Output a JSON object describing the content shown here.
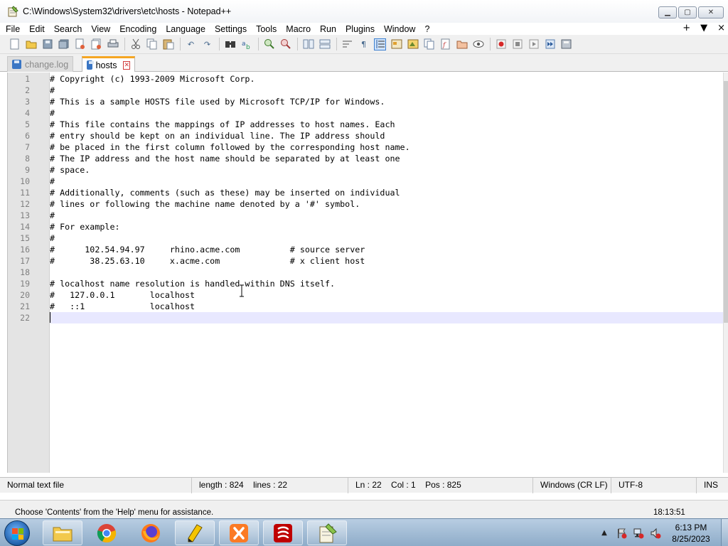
{
  "window": {
    "title": "C:\\Windows\\System32\\drivers\\etc\\hosts - Notepad++"
  },
  "menu": {
    "items": [
      "File",
      "Edit",
      "Search",
      "View",
      "Encoding",
      "Language",
      "Settings",
      "Tools",
      "Macro",
      "Run",
      "Plugins",
      "Window",
      "?"
    ],
    "right": [
      "+",
      "▼",
      "×"
    ]
  },
  "tabs": [
    {
      "label": "change.log",
      "active": false
    },
    {
      "label": "hosts",
      "active": true
    }
  ],
  "editor": {
    "lines": [
      "# Copyright (c) 1993-2009 Microsoft Corp.",
      "#",
      "# This is a sample HOSTS file used by Microsoft TCP/IP for Windows.",
      "#",
      "# This file contains the mappings of IP addresses to host names. Each",
      "# entry should be kept on an individual line. The IP address should",
      "# be placed in the first column followed by the corresponding host name.",
      "# The IP address and the host name should be separated by at least one",
      "# space.",
      "#",
      "# Additionally, comments (such as these) may be inserted on individual",
      "# lines or following the machine name denoted by a '#' symbol.",
      "#",
      "# For example:",
      "#",
      "#      102.54.94.97     rhino.acme.com          # source server",
      "#       38.25.63.10     x.acme.com              # x client host",
      "",
      "# localhost name resolution is handled within DNS itself.",
      "#   127.0.0.1       localhost",
      "#   ::1             localhost",
      ""
    ],
    "current_line": 22
  },
  "statusbar": {
    "file_type": "Normal text file",
    "length": "length : 824",
    "lines": "lines : 22",
    "ln": "Ln : 22",
    "col": "Col : 1",
    "pos": "Pos : 825",
    "eol": "Windows (CR LF)",
    "encoding": "UTF-8",
    "mode": "INS"
  },
  "hint": {
    "text": "Choose 'Contents' from the 'Help' menu for assistance.",
    "time": "18:13:51"
  },
  "taskbar": {
    "apps": [
      "file-explorer",
      "chrome",
      "firefox",
      "sublime-text",
      "xampp",
      "filezilla",
      "notepad-plus-plus"
    ],
    "clock_time": "6:13 PM",
    "clock_date": "8/25/2023"
  },
  "colors": {
    "active_tab_accent": "#f5a623",
    "current_line": "#e8e8ff",
    "gutter": "#e4e4e4",
    "taskbar": "#a9c1da"
  }
}
